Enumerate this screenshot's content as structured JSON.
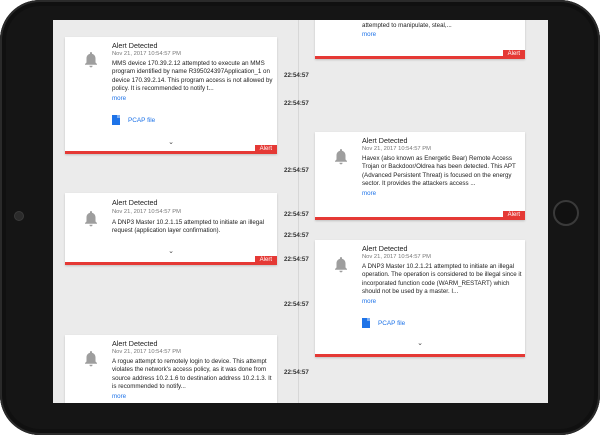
{
  "alerts": [
    {
      "title": "Alert Detected",
      "date": "Nov 21, 2017 10:54:57 PM",
      "message": "MMS device 170.39.2.12 attempted to execute an MMS program identified by name R395024397Application_1 on device 170.39.2.14. This program access is not allowed by policy. It is recommended to notify t...",
      "more": "more",
      "pcap": "PCAP file",
      "tag": "Alert",
      "time": "22:54:57"
    },
    {
      "title": "Alert Detected",
      "date": "Nov 21, 2017 10:54:57 PM",
      "message": "A DNP3 Master 10.2.1.15 attempted to initiate an illegal request (application layer confirmation).",
      "tag": "Alert",
      "time": "22:54:57"
    },
    {
      "title": "Alert Detected",
      "date": "Nov 21, 2017 10:54:57 PM",
      "message": "A rogue attempt to remotely login to device. This attempt violates the network's access policy, as it was done from source address 10.2.1.6 to destination address 10.2.1.3. It is recommended to notify...",
      "more": "more",
      "time": "22:54:57"
    },
    {
      "message_tail": "attempted to manipulate, steal,...",
      "more": "more",
      "tag": "Alert",
      "time": "22:54:57"
    },
    {
      "title": "Alert Detected",
      "date": "Nov 21, 2017 10:54:57 PM",
      "message": "Havex (also known as Energetic Bear) Remote Access Trojan or Backdoor/Oldrea has been detected. This APT (Advanced Persistent Threat) is focused on the energy sector. It provides the attackers access ...",
      "more": "more",
      "tag": "Alert",
      "time": "22:54:57"
    },
    {
      "title": "Alert Detected",
      "date": "Nov 21, 2017 10:54:57 PM",
      "message": "A DNP3 Master 10.2.1.21 attempted to initiate an illegal operation. The operation is considered to be illegal since it incorporated function code (WARM_RESTART) which should not be used by a master. I...",
      "more": "more",
      "pcap": "PCAP file",
      "time": "22:54:57"
    }
  ],
  "extra_times": [
    "22:54:57",
    "22:54:57",
    "22:54:57"
  ],
  "colors": {
    "accent_red": "#e53935",
    "link_blue": "#1e73e8"
  },
  "icons": {
    "alert": "bell-icon",
    "file": "file-icon",
    "expand": "chevron-down-icon"
  }
}
